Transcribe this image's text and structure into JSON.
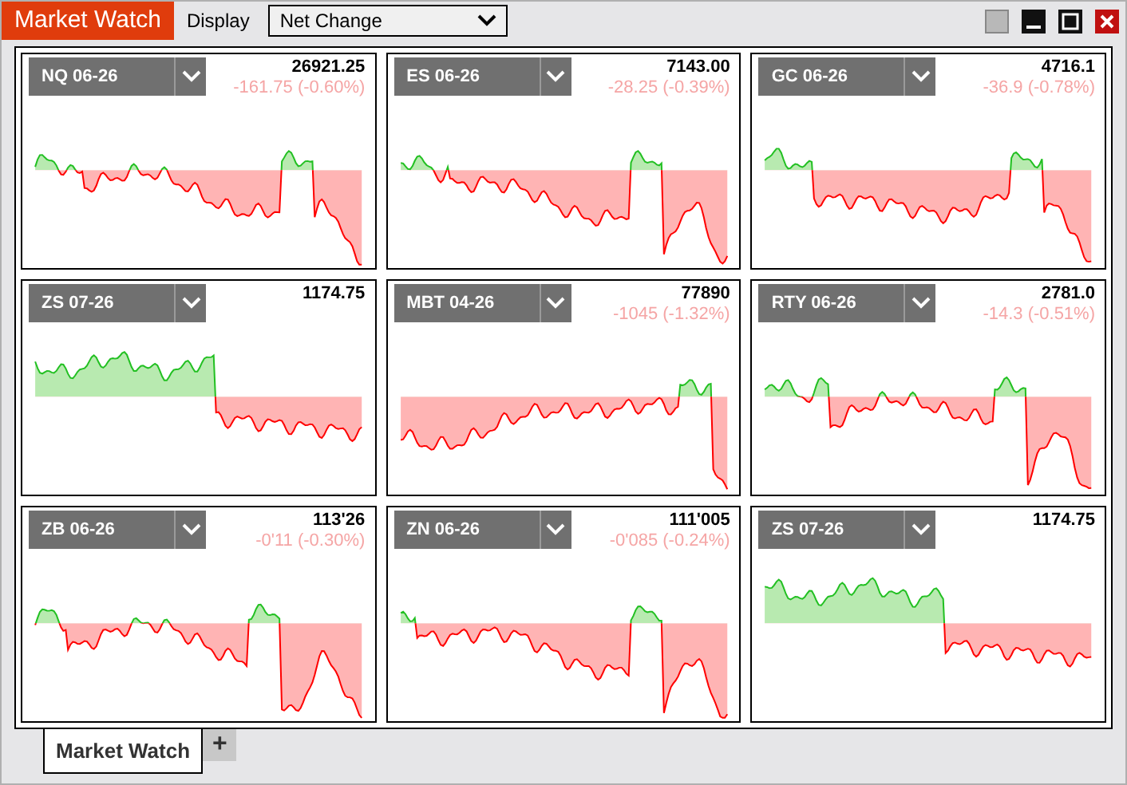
{
  "window": {
    "title": "Market Watch"
  },
  "display": {
    "label": "Display",
    "value": "Net Change"
  },
  "tiles": [
    {
      "symbol": "NQ 06-26",
      "price": "26921.25",
      "change": "-161.75 (-0.60%)"
    },
    {
      "symbol": "ES 06-26",
      "price": "7143.00",
      "change": "-28.25 (-0.39%)"
    },
    {
      "symbol": "GC 06-26",
      "price": "4716.1",
      "change": "-36.9 (-0.78%)"
    },
    {
      "symbol": "ZS 07-26",
      "price": "1174.75"
    },
    {
      "symbol": "MBT 04-26",
      "price": "77890",
      "change": "-1045 (-1.32%)"
    },
    {
      "symbol": "RTY 06-26",
      "price": "2781.0",
      "change": "-14.3 (-0.51%)"
    },
    {
      "symbol": "ZB 06-26",
      "price": "113'26",
      "change": "-0'11 (-0.30%)"
    },
    {
      "symbol": "ZN 06-26",
      "price": "111'005",
      "change": "-0'085 (-0.24%)"
    },
    {
      "symbol": "ZS 07-26",
      "price": "1174.75"
    }
  ],
  "tabs": [
    {
      "label": "Market Watch",
      "selected": true
    },
    {
      "label": "+",
      "selected": false
    }
  ]
}
